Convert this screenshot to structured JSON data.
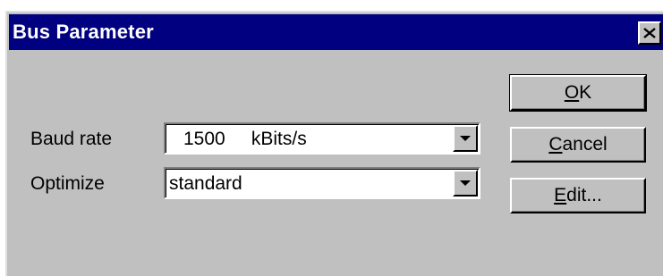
{
  "dialog": {
    "title": "Bus Parameter",
    "close_icon": "close-icon"
  },
  "fields": {
    "baud_rate": {
      "label": "Baud rate",
      "value": "1500     kBits/s"
    },
    "optimize": {
      "label": "Optimize",
      "value": "standard"
    }
  },
  "buttons": {
    "ok": {
      "mnemonic": "O",
      "rest": "K"
    },
    "cancel": {
      "mnemonic": "C",
      "rest": "ancel"
    },
    "edit": {
      "mnemonic": "E",
      "rest": "dit..."
    }
  },
  "colors": {
    "titlebar": "#000080",
    "face": "#c0c0c0",
    "field": "#ffffff"
  }
}
